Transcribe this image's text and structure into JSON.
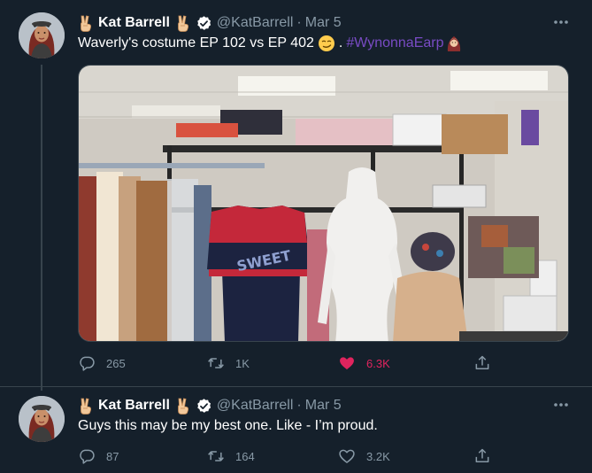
{
  "colors": {
    "background": "#15202b",
    "secondary_text": "#8899a6",
    "hashtag": "#794bc4",
    "like_active": "#e0245e",
    "verified": "#ffffff",
    "divider": "#38444d"
  },
  "tweets": [
    {
      "author": {
        "name": "Kat Barrell",
        "handle": "@KatBarrell",
        "verified": true,
        "name_emoji_left": "victory-hand-emoji",
        "name_emoji_right": "victory-hand-emoji"
      },
      "separator": "·",
      "date": "Mar 5",
      "text": "Waverly's costume EP 102 vs EP 402",
      "text_emoji": "smirking-face-emoji",
      "hashtag": "#WynonnaEarp",
      "hashtag_emoji": "woman-emoji",
      "media_description": "costume racks with a red sweater and a white mannequin",
      "actions": {
        "reply": "265",
        "retweet": "1K",
        "like": "6.3K",
        "liked": true,
        "share_icon": "share-icon"
      }
    },
    {
      "author": {
        "name": "Kat Barrell",
        "handle": "@KatBarrell",
        "verified": true,
        "name_emoji_left": "victory-hand-emoji",
        "name_emoji_right": "victory-hand-emoji"
      },
      "separator": "·",
      "date": "Mar 5",
      "text": "Guys this may be my best one. Like - I’m proud.",
      "actions": {
        "reply": "87",
        "retweet": "164",
        "like": "3.2K",
        "liked": false,
        "share_icon": "share-icon"
      }
    }
  ]
}
